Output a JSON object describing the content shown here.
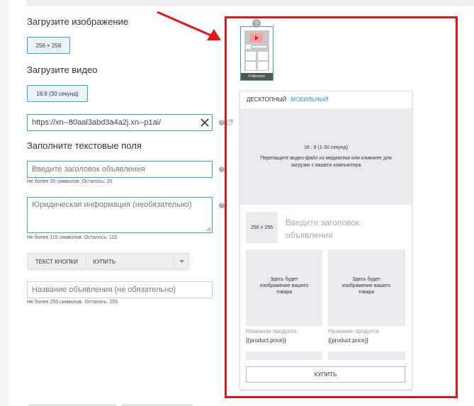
{
  "upload_image": {
    "heading": "Загрузите изображение",
    "size_button": "256 × 256"
  },
  "upload_video": {
    "heading": "Загрузите видео",
    "ratio_button": "16:9 (30 секунд)"
  },
  "url_field": {
    "value": "https://xn--80aal3abd3a4a2j.xn--p1ai/"
  },
  "text_fields": {
    "heading": "Заполните текстовые поля",
    "title_placeholder": "Введите заголовок объявления",
    "title_hint": "Не более 25 символов. Осталось: 25",
    "legal_placeholder": "Юридическая информация (необязательно)",
    "legal_hint": "Не более 115 символов. Осталось: 115",
    "name_placeholder": "Название объявления (не обязательно)",
    "name_hint": "Не более 255 символов. Осталось: 255"
  },
  "cta": {
    "label": "ТЕКСТ КНОПКИ",
    "value": "КУПИТЬ"
  },
  "preview": {
    "format_badge": "Fullscreen",
    "help_mark": "?",
    "tab_desktop": "ДЕСКТОПНЫЙ",
    "tab_mobile": "МОБИЛЬНЫЙ",
    "video_ratio": "16 : 9 (1-30 секунд)",
    "video_instruction": "Перетащите видео-файл из медиатеки или кликните для загрузки с вашего компьютера",
    "logo_size": "256 × 256",
    "title_placeholder": "Введите заголовок объявления",
    "product_image_text": "Здесь будет изображение вашего товара",
    "product_name": "Название продукта",
    "product_price": "{{product.price}}",
    "buy_button": "КУПИТЬ"
  },
  "colors": {
    "accent": "#3aa1c9",
    "annotation": "#e8141a",
    "mobile_tab": "#1a9fd6"
  }
}
